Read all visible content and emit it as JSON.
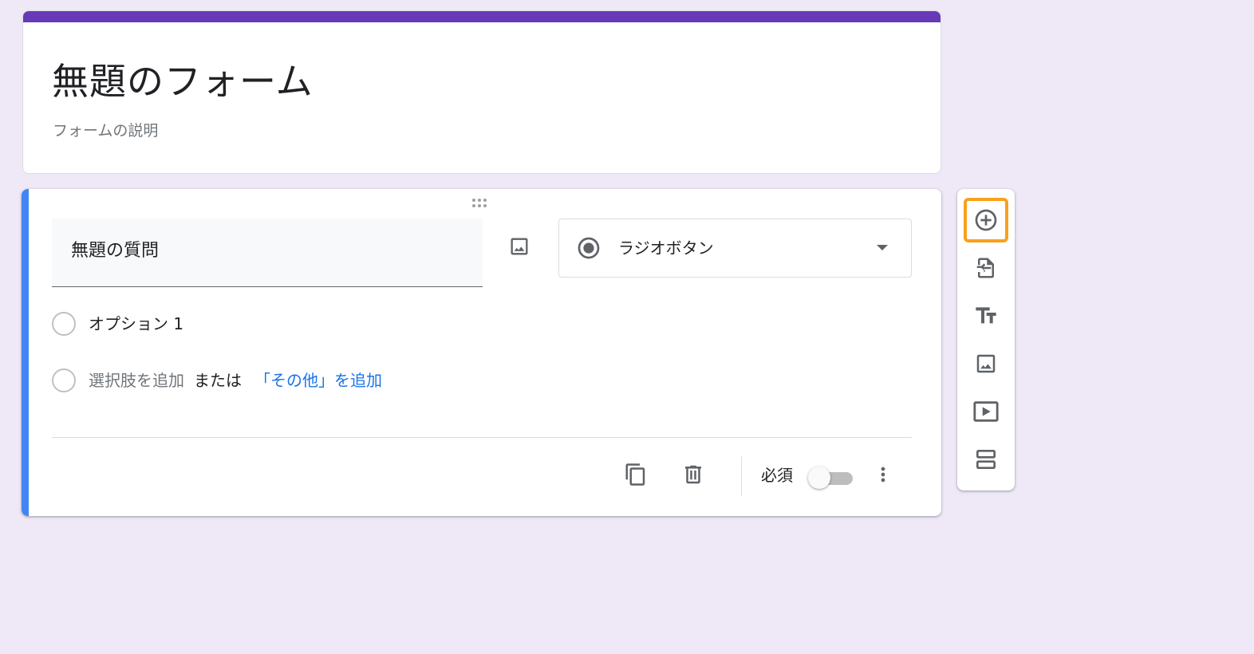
{
  "form": {
    "title": "無題のフォーム",
    "description": "フォームの説明",
    "accent_color": "#673ab7"
  },
  "question": {
    "title": "無題の質問",
    "type_label": "ラジオボタン",
    "options": [
      {
        "label": "オプション 1"
      }
    ],
    "add_option_label": "選択肢を追加",
    "or_label": "または",
    "add_other_label": "「その他」を追加",
    "required_label": "必須",
    "required": false,
    "active_bar_color": "#4285f4"
  },
  "icons": {
    "drag": "drag-handle-icon",
    "image": "image-icon",
    "radio": "radio-button-icon",
    "dropdown": "arrow-drop-down-icon",
    "copy": "copy-icon",
    "delete": "delete-icon",
    "more": "more-vert-icon"
  },
  "toolbar": {
    "items": [
      {
        "name": "add-question",
        "icon": "add-circle-icon",
        "focused": true
      },
      {
        "name": "import-questions",
        "icon": "import-file-icon"
      },
      {
        "name": "add-title-description",
        "icon": "text-fields-icon"
      },
      {
        "name": "add-image",
        "icon": "image-icon"
      },
      {
        "name": "add-video",
        "icon": "video-icon"
      },
      {
        "name": "add-section",
        "icon": "section-icon"
      }
    ],
    "focus_color": "#f9a01b"
  }
}
